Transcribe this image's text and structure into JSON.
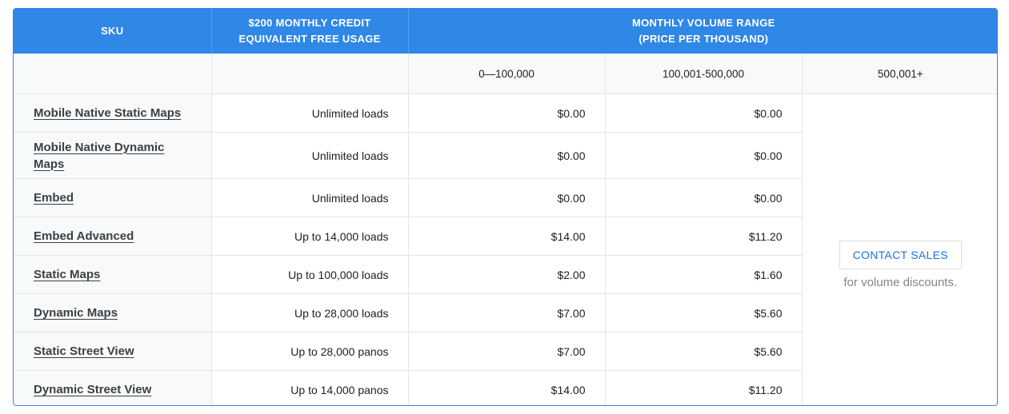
{
  "header": {
    "sku": "SKU",
    "credit": "$200 MONTHLY CREDIT EQUIVALENT FREE USAGE",
    "volume": "MONTHLY VOLUME RANGE (PRICE PER THOUSAND)"
  },
  "ranges": [
    "0—100,000",
    "100,001-500,000",
    "500,001+"
  ],
  "rows": [
    {
      "sku": "Mobile Native Static Maps",
      "free": "Unlimited loads",
      "p1": "$0.00",
      "p2": "$0.00"
    },
    {
      "sku": "Mobile Native Dynamic Maps",
      "free": "Unlimited loads",
      "p1": "$0.00",
      "p2": "$0.00"
    },
    {
      "sku": "Embed",
      "free": "Unlimited loads",
      "p1": "$0.00",
      "p2": "$0.00"
    },
    {
      "sku": "Embed Advanced",
      "free": "Up to 14,000 loads",
      "p1": "$14.00",
      "p2": "$11.20"
    },
    {
      "sku": "Static Maps",
      "free": "Up to 100,000 loads",
      "p1": "$2.00",
      "p2": "$1.60"
    },
    {
      "sku": "Dynamic Maps",
      "free": "Up to 28,000 loads",
      "p1": "$7.00",
      "p2": "$5.60"
    },
    {
      "sku": "Static Street View",
      "free": "Up to 28,000 panos",
      "p1": "$7.00",
      "p2": "$5.60"
    },
    {
      "sku": "Dynamic Street View",
      "free": "Up to 14,000 panos",
      "p1": "$14.00",
      "p2": "$11.20"
    }
  ],
  "contact": {
    "button": "CONTACT SALES",
    "note": "for volume discounts."
  }
}
